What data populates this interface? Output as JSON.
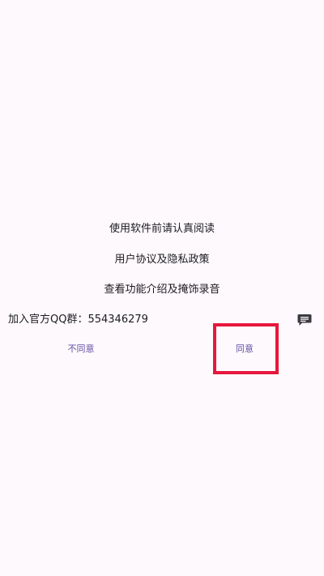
{
  "dialog": {
    "line1": "使用软件前请认真阅读",
    "line2": "用户协议及隐私政策",
    "line3": "查看功能介绍及掩饰录音",
    "qq_label": "加入官方QQ群：554346279",
    "chat_icon": "chat-icon"
  },
  "buttons": {
    "disagree": "不同意",
    "agree": "同意"
  },
  "colors": {
    "background": "#fdf9fd",
    "text": "#1c1b1f",
    "accent": "#6750a4",
    "highlight": "#e6173d"
  }
}
